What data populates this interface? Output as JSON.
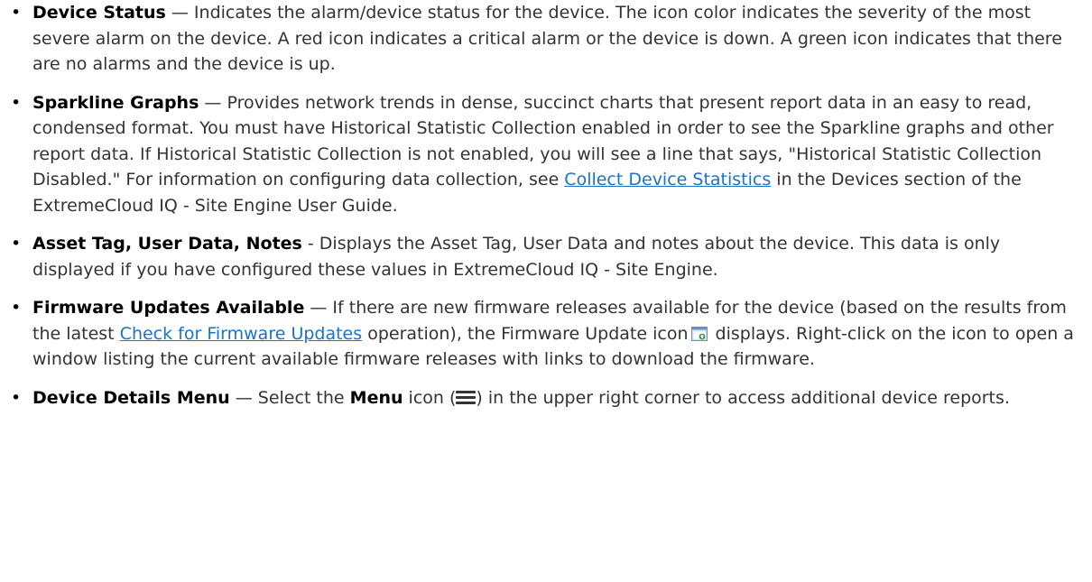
{
  "items": [
    {
      "term": "Device Status",
      "sep": " — ",
      "text": "Indicates the alarm/device status for the device. The icon color indicates the severity of the most severe alarm on the device. A red icon indicates a critical alarm or the device is down. A green icon indicates that there are no alarms and the device is up."
    },
    {
      "term": "Sparkline Graphs",
      "sep": " — ",
      "text_before_link": "Provides network trends in dense, succinct charts that present report data in an easy to read, condensed format. You must have Historical Statistic Collection enabled in order to see the Sparkline graphs and other report data. If Historical Statistic Collection is not enabled, you will see a line that says, \"Historical Statistic Collection Disabled.\" For information on configuring data collection, see ",
      "link": "Collect Device Statistics",
      "text_after_link": " in the Devices section of the ExtremeCloud IQ - Site Engine User Guide."
    },
    {
      "term": "Asset Tag, User Data, Notes",
      "sep": " - ",
      "text": "Displays the Asset Tag, User Data and notes about the device. This data is only displayed if you have configured these values in ExtremeCloud IQ - Site Engine."
    },
    {
      "term": "Firmware Updates Available",
      "sep": " — ",
      "text_before_link": "If there are new firmware releases available for the device (based on the results from the latest ",
      "link": "Check for Firmware Updates",
      "text_after_link": " operation), the Firmware Update icon",
      "text_after_icon": " displays. Right-click on the icon to open a window listing the current available firmware releases with links to download the firmware."
    },
    {
      "term": "Device Details Menu",
      "sep": " — ",
      "text_before": "Select the ",
      "menu_word": "Menu",
      "text_mid": " icon (",
      "text_after": ") in the upper right corner to access additional device reports."
    }
  ],
  "bullet": "•",
  "colors": {
    "text": "#333333",
    "term": "#000000",
    "link": "#1a73c9"
  },
  "icons": {
    "firmware": "firmware-update-icon",
    "menu": "menu-icon"
  }
}
